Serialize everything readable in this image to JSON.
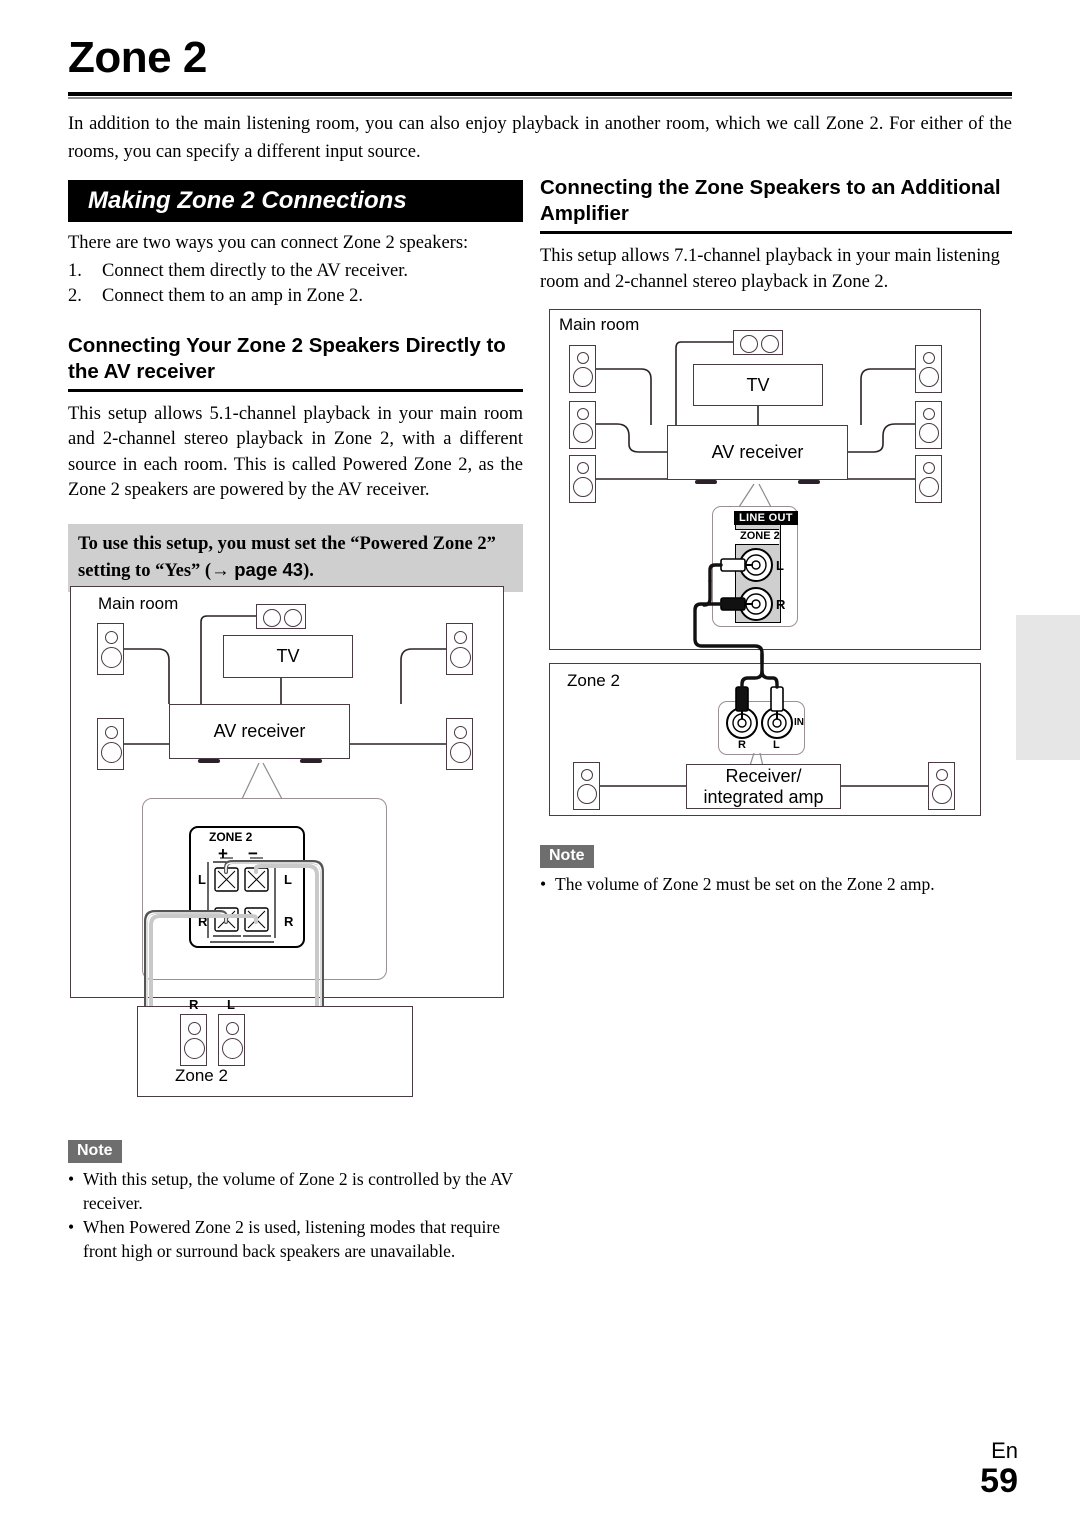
{
  "page": {
    "title": "Zone 2",
    "intro": "In addition to the main listening room, you can also enjoy playback in another room, which we call Zone 2. For either of the rooms, you can specify a different input source.",
    "footer_lang": "En",
    "footer_page": "59"
  },
  "left_column": {
    "banner": "Making Zone 2 Connections",
    "lead": "There are two ways you can connect Zone 2 speakers:",
    "steps": [
      {
        "num": "1.",
        "text": "Connect them directly to the AV receiver."
      },
      {
        "num": "2.",
        "text": "Connect them to an amp in Zone 2."
      }
    ],
    "subhead": "Connecting Your Zone 2 Speakers Directly to the AV receiver",
    "paragraph": "This setup allows 5.1-channel playback in your main room and 2-channel stereo playback in Zone 2, with a different source in each room. This is called Powered Zone 2, as the Zone 2 speakers are powered by the AV receiver.",
    "callout": {
      "text_before": "To use this setup, you must set the “Powered Zone 2” setting to “Yes” (",
      "arrow": "→",
      "page_ref": "page 43",
      "text_after": ")."
    },
    "note": {
      "badge": "Note",
      "items": [
        "With this setup, the volume of Zone 2 is controlled by the AV receiver.",
        "When Powered Zone 2 is used, listening modes that require front high or surround back speakers are unavailable."
      ]
    },
    "diagram": {
      "main_room_label": "Main room",
      "tv_label": "TV",
      "receiver_label": "AV receiver",
      "zone2_room_label": "Zone 2",
      "terminal_title": "ZONE 2",
      "terminal_plus": "+",
      "terminal_minus": "−",
      "terminal_left_top": "L",
      "terminal_right_top": "L",
      "terminal_left_bottom": "R",
      "terminal_right_bottom": "R",
      "zone2_speaker_r": "R",
      "zone2_speaker_l": "L"
    }
  },
  "right_column": {
    "subhead": "Connecting the Zone Speakers to an Additional Amplifier",
    "paragraph": "This setup allows 7.1-channel playback in your main listening room and 2-channel stereo playback in Zone 2.",
    "note": {
      "badge": "Note",
      "items": [
        "The volume of Zone 2 must be set on the Zone 2 amp."
      ]
    },
    "diagram": {
      "main_room_label": "Main room",
      "tv_label": "TV",
      "receiver_label": "AV receiver",
      "line_out_label": "LINE OUT",
      "zone2_jack_label": "ZONE 2",
      "jack_l": "L",
      "jack_r": "R",
      "zone2_room_label": "Zone 2",
      "amp_label": "Receiver/ integrated amp",
      "amp_line1": "Receiver/",
      "amp_line2": "integrated amp",
      "in_label": "IN",
      "in_r": "R",
      "in_l": "L"
    }
  },
  "colors": {
    "banner_bg": "#000000",
    "callout_bg": "#cfcfcf",
    "note_badge_bg": "#6e6e6e",
    "side_tab_bg": "#e6e6e6",
    "diagram_stroke": "#4a3a44",
    "wire": "#2a2228"
  }
}
